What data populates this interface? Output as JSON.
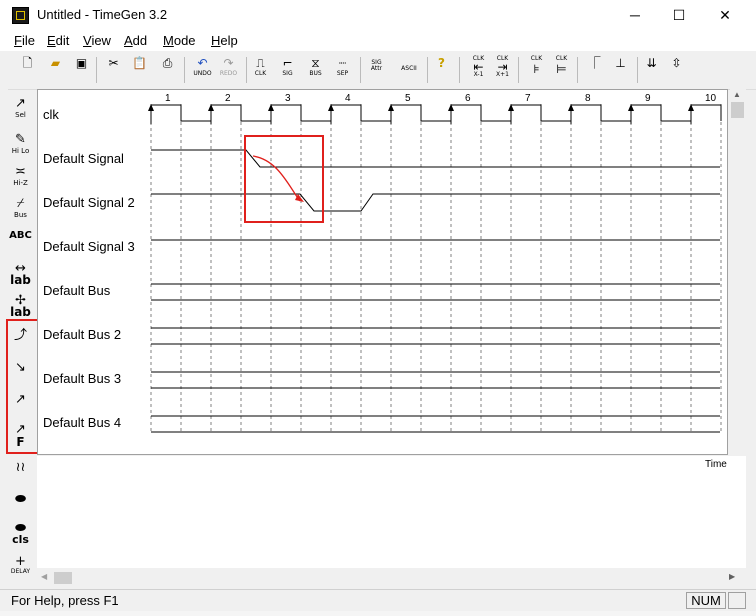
{
  "window": {
    "title": "Untitled - TimeGen 3.2",
    "minimize_glyph": "─",
    "maximize_glyph": "☐",
    "close_glyph": "✕"
  },
  "menu": [
    "File",
    "Edit",
    "View",
    "Add",
    "Mode",
    "Help"
  ],
  "menu_underline": [
    "F",
    "E",
    "V",
    "A",
    "M",
    "H"
  ],
  "toolbar": {
    "undo": "UNDO",
    "redo": "REDO",
    "clk": "CLK",
    "sig": "SIG",
    "bus": "BUS",
    "sep": "SEP",
    "sig_attr": "SIG Attr",
    "ascii": "ASCII",
    "clk_x_minus": "X-1",
    "clk_x_plus": "X+1",
    "clk_label": "CLK"
  },
  "palette": {
    "sel": "Sel",
    "hilo": "Hi Lo",
    "hiz": "Hi-Z",
    "bus": "Bus",
    "abc": "ABC",
    "lab1": "lab",
    "lab2": "lab",
    "f": "F",
    "cls": "cls",
    "delay": "DELAY"
  },
  "signals": [
    {
      "name": "clk",
      "type": "clock"
    },
    {
      "name": "Default Signal",
      "type": "signal"
    },
    {
      "name": "Default Signal 2",
      "type": "signal"
    },
    {
      "name": "Default Signal 3",
      "type": "signal"
    },
    {
      "name": "Default Bus",
      "type": "bus"
    },
    {
      "name": "Default Bus 2",
      "type": "bus"
    },
    {
      "name": "Default Bus 3",
      "type": "bus"
    },
    {
      "name": "Default Bus 4",
      "type": "bus"
    }
  ],
  "clock_ticks": [
    "1",
    "2",
    "3",
    "4",
    "5",
    "6",
    "7",
    "8",
    "9",
    "10"
  ],
  "time_label": "Time",
  "status": {
    "message": "For Help, press F1",
    "num": "NUM"
  },
  "colors": {
    "annotation": "#e0201c",
    "signal": "#000000"
  }
}
